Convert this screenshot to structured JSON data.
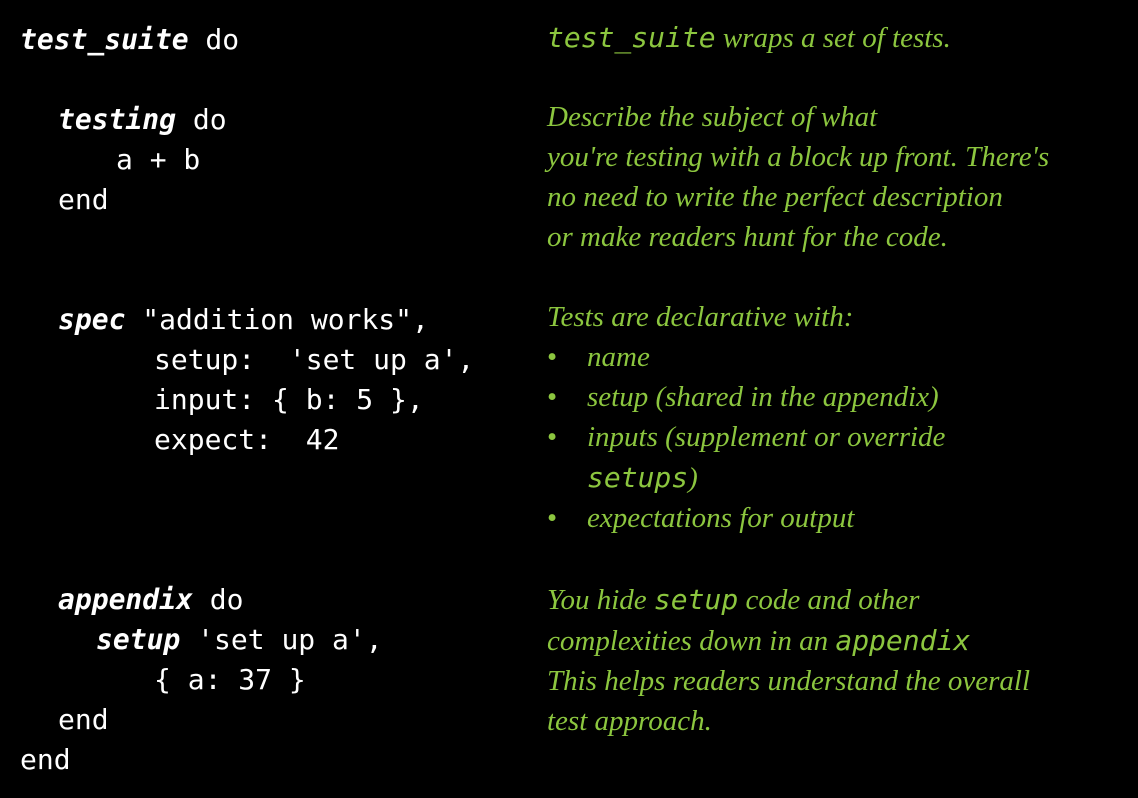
{
  "code": {
    "l1_kw": "test_suite",
    "l1_rest": " do",
    "l3_kw": "testing",
    "l3_rest": " do",
    "l4": "a + b",
    "l5": "end",
    "l8_kw": "spec",
    "l8_rest": " \"addition works\",",
    "l9": "setup:  'set up a',",
    "l10": "input: { b: 5 },",
    "l11": "expect:  42",
    "l15_kw": "appendix",
    "l15_rest": " do",
    "l16_kw": "setup",
    "l16_rest": " 'set up a',",
    "l17": "{ a: 37 }",
    "l18": "end",
    "l19": "end"
  },
  "notes": {
    "n1_code": "test_suite",
    "n1_text": " wraps a set of tests.",
    "n2": [
      "Describe the subject of what",
      "you're testing with a block up front. There's",
      "no need to write the perfect description",
      "or make readers hunt for the code."
    ],
    "n3_intro": "Tests are declarative with:",
    "bullet_char": "•",
    "n3_b1": "name",
    "n3_b2": "setup (shared in the appendix)",
    "n3_b3": "inputs (supplement or override",
    "n3_b3_code": "setups",
    "n3_b3_close": ")",
    "n3_b4": "expectations for output",
    "n4_l1_pre": "You hide ",
    "n4_l1_code": "setup",
    "n4_l1_post": " code and other",
    "n4_l2_pre": "complexities down in an ",
    "n4_l2_code": "appendix",
    "n4_l3": "This helps readers understand the overall",
    "n4_l4": "test approach."
  },
  "colors": {
    "background": "#000000",
    "code_text": "#ffffff",
    "annotation_text": "#8cc63f"
  }
}
